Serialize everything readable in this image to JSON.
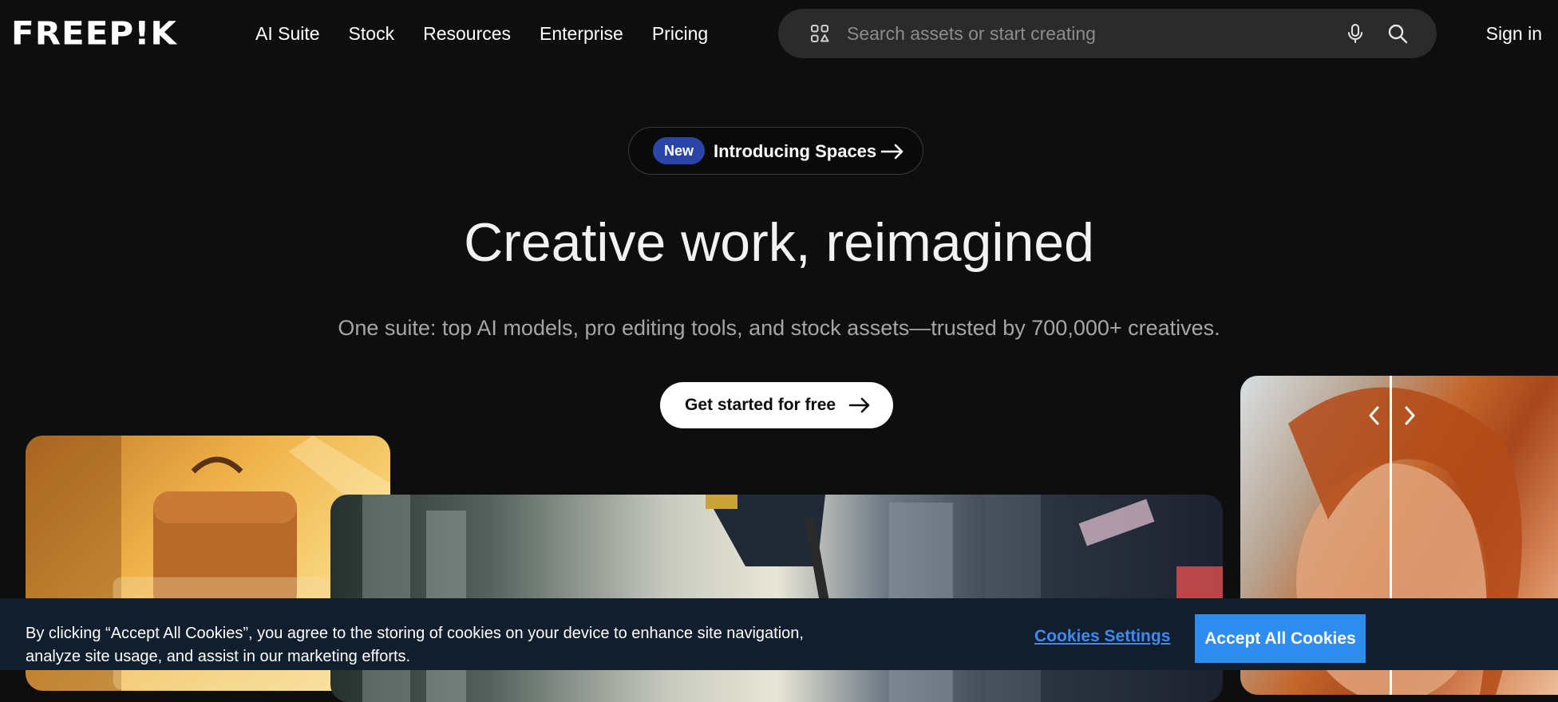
{
  "header": {
    "logo": "FREEP!K",
    "nav": [
      "AI Suite",
      "Stock",
      "Resources",
      "Enterprise",
      "Pricing"
    ],
    "search_placeholder": "Search assets or start creating",
    "sign_in": "Sign in"
  },
  "hero": {
    "badge": "New",
    "announcement": "Introducing Spaces",
    "headline": "Creative work, reimagined",
    "subheadline": "One suite: top AI models, pro editing tools, and stock assets—trusted by 700,000+ creatives.",
    "cta": "Get started for free"
  },
  "cookie_banner": {
    "text": "By clicking “Accept All Cookies”, you agree to the storing of cookies on your device to enhance site navigation, analyze site usage, and assist in our marketing efforts.",
    "settings_label": "Cookies Settings",
    "accept_label": "Accept All Cookies"
  },
  "colors": {
    "background": "#0e0e0e",
    "badge": "#2a44a8",
    "cookie_bar": "#111e2e",
    "accept_button": "#2f8df0",
    "settings_link": "#3d8bf0"
  },
  "icons": [
    "apps-icon",
    "microphone-icon",
    "search-icon",
    "arrow-right-icon",
    "chevron-left-icon",
    "chevron-right-icon"
  ]
}
